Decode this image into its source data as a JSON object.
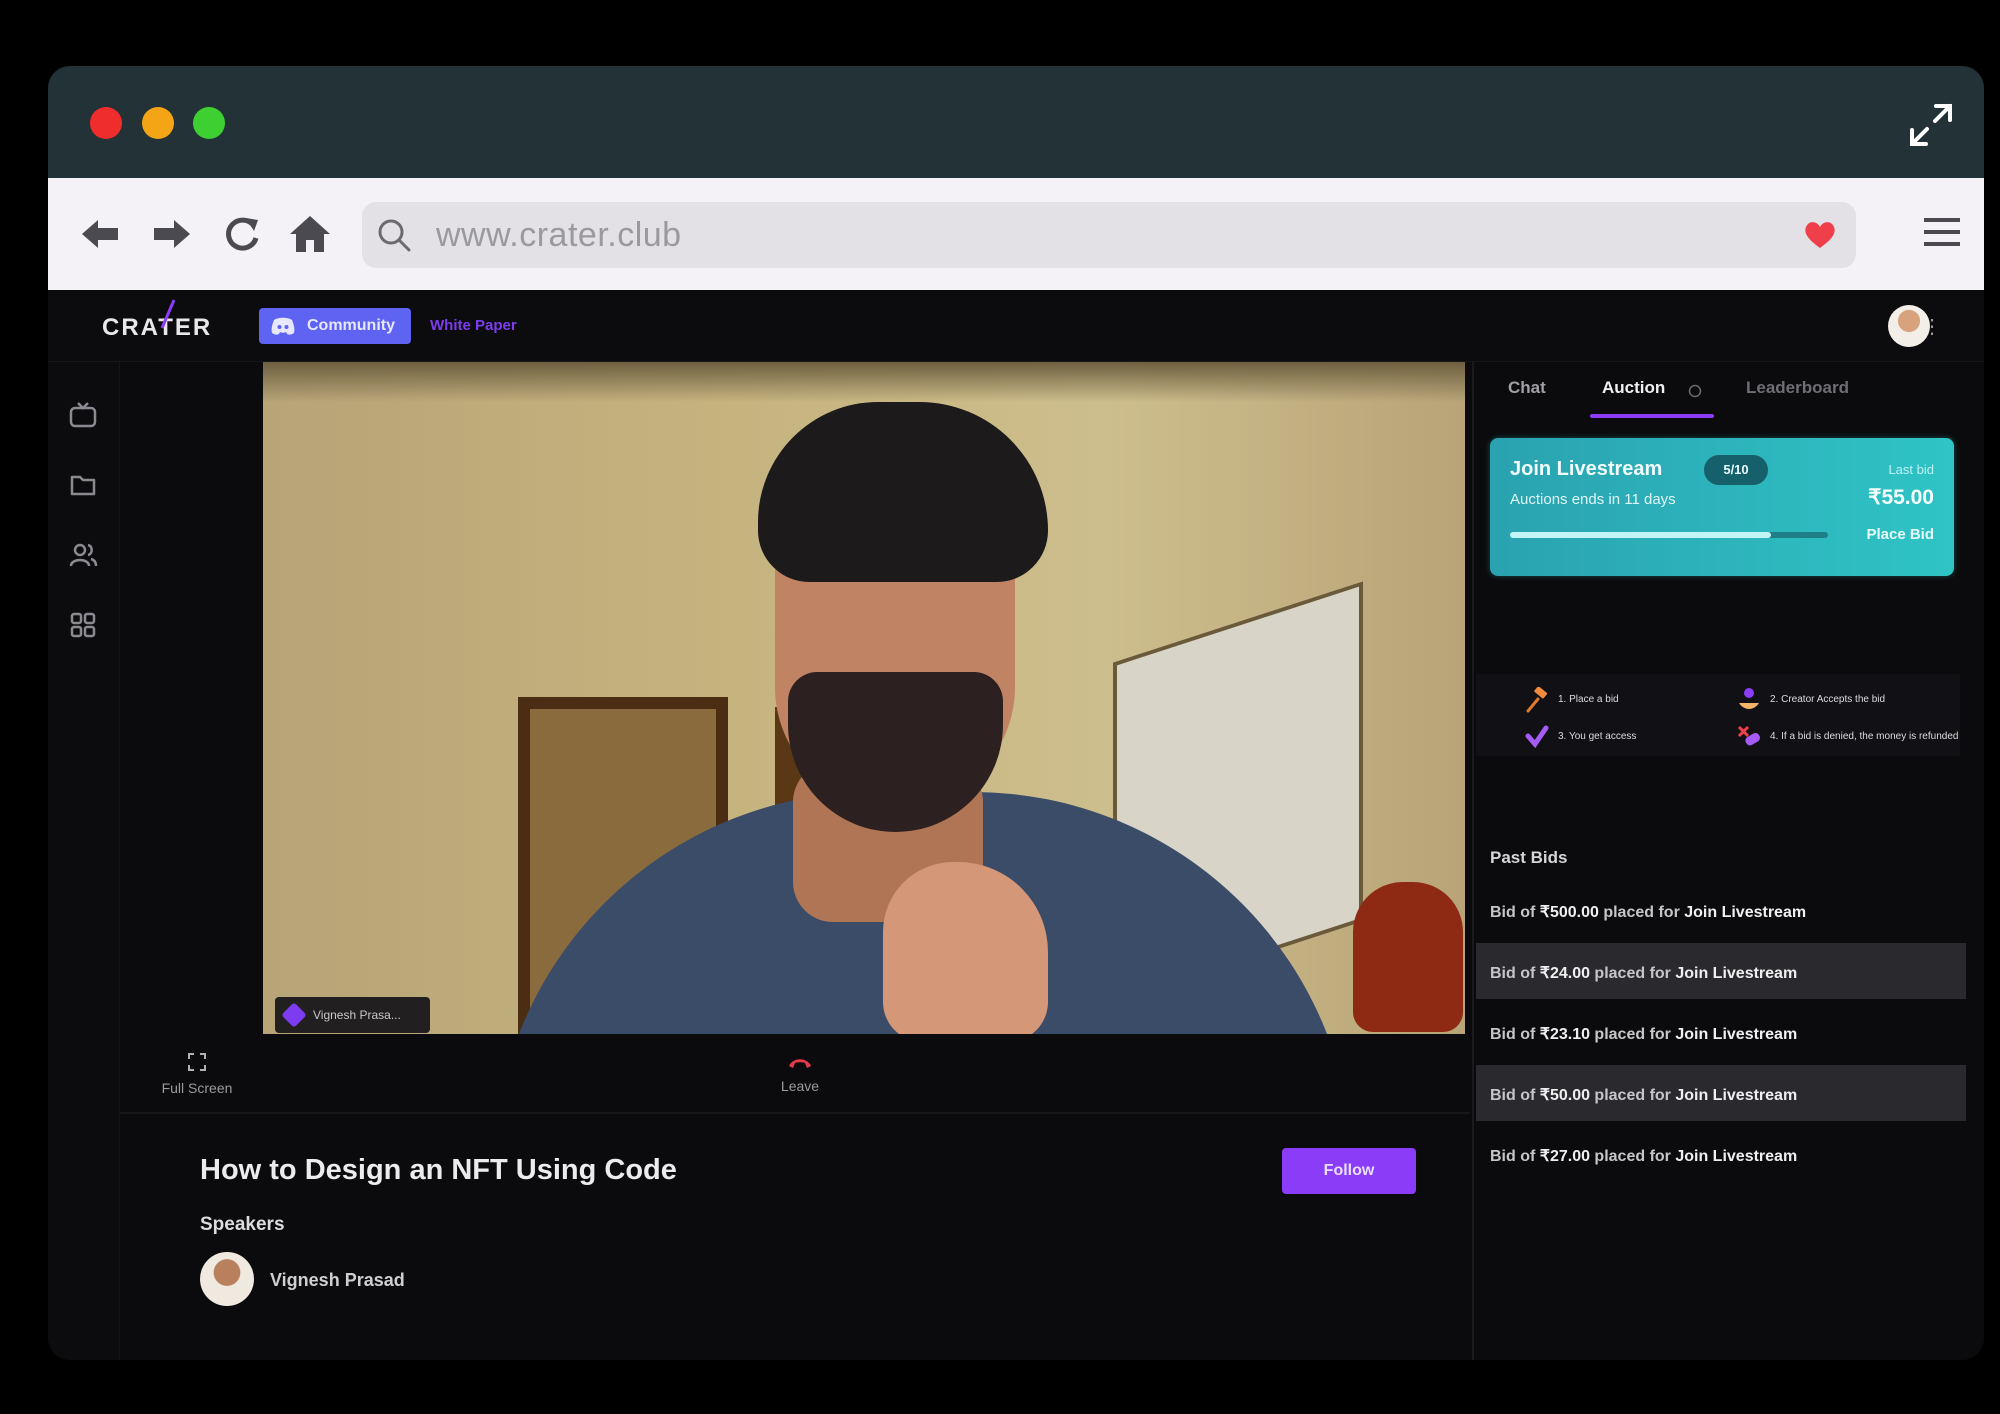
{
  "browser": {
    "url": "www.crater.club"
  },
  "app": {
    "logo": "CRATER",
    "community_label": "Community",
    "whitepaper_label": "White Paper"
  },
  "video": {
    "participant_name": "Vignesh Prasa...",
    "controls": {
      "fullscreen_label": "Full Screen",
      "leave_label": "Leave"
    }
  },
  "session": {
    "title": "How to Design an NFT Using Code",
    "follow_label": "Follow",
    "speakers_heading": "Speakers",
    "speaker_name": "Vignesh Prasad"
  },
  "panel": {
    "tabs": [
      {
        "label": "Chat"
      },
      {
        "label": "Auction"
      },
      {
        "label": "Leaderboard"
      }
    ],
    "auction_card": {
      "title": "Join Livestream",
      "badge": "5/10",
      "subtitle": "Auctions ends in 11 days",
      "last_bid_label": "Last bid",
      "last_bid_value": "₹55.00",
      "place_bid_label": "Place Bid",
      "progress": 0.82
    },
    "steps": [
      {
        "text": "1. Place a bid",
        "icon": "gavel-icon"
      },
      {
        "text": "2. Creator Accepts the bid",
        "icon": "creator-icon"
      },
      {
        "text": "3. You get access",
        "icon": "check-icon"
      },
      {
        "text": "4. If a bid is denied, the money is refunded",
        "icon": "refund-icon"
      }
    ],
    "past_bids_heading": "Past Bids",
    "past_bids": [
      {
        "prefix": "Bid of ",
        "amount": "₹500.00",
        "mid": " placed for ",
        "item": "Join Livestream"
      },
      {
        "prefix": "Bid of ",
        "amount": "₹24.00",
        "mid": " placed for ",
        "item": "Join Livestream"
      },
      {
        "prefix": "Bid of ",
        "amount": "₹23.10",
        "mid": " placed for ",
        "item": "Join Livestream"
      },
      {
        "prefix": "Bid of ",
        "amount": "₹50.00",
        "mid": " placed for ",
        "item": "Join Livestream"
      },
      {
        "prefix": "Bid of ",
        "amount": "₹27.00",
        "mid": " placed for ",
        "item": "Join Livestream"
      }
    ]
  },
  "colors": {
    "accent_purple": "#8a3cf6",
    "discord_blue": "#5e63f2",
    "card_teal": "#2fc4c6",
    "titlebar": "#233237"
  }
}
